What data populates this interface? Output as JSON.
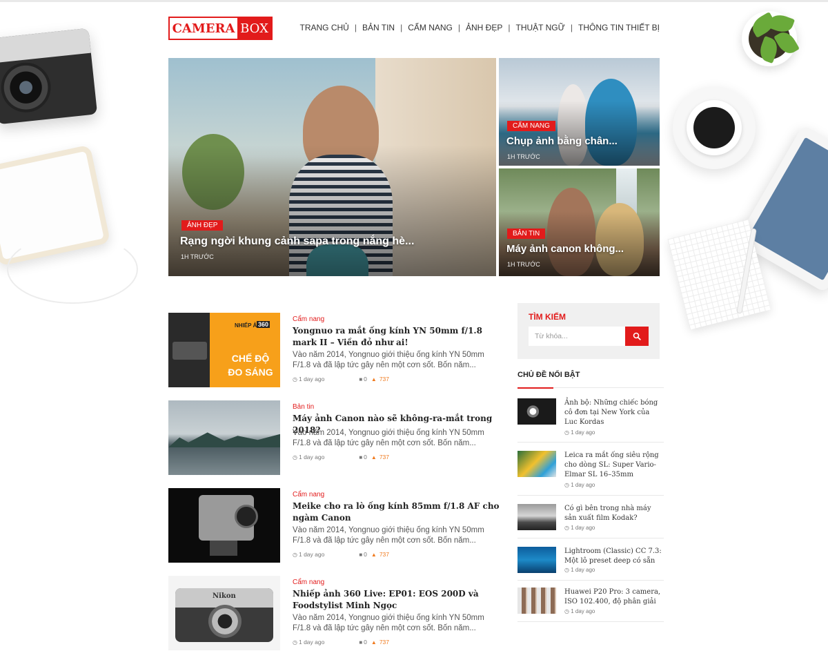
{
  "brand": {
    "logo_left": "CAMERA",
    "logo_right": "BOX",
    "accent_color": "#e21b1b"
  },
  "nav": [
    {
      "label": "TRANG CHỦ"
    },
    {
      "label": "BẢN TIN"
    },
    {
      "label": "CẨM NANG"
    },
    {
      "label": "ẢNH ĐẸP"
    },
    {
      "label": "THUẬT NGỮ"
    },
    {
      "label": "THÔNG TIN THIẾT BỊ"
    }
  ],
  "hero": {
    "main": {
      "category": "ẢNH ĐẸP",
      "title": "Rạng ngời khung cảnh sapa trong nắng hè...",
      "time": "1H TRƯỚC"
    },
    "side": [
      {
        "category": "CẨM NANG",
        "title": "Chụp ảnh bằng chân...",
        "time": "1H TRƯỚC"
      },
      {
        "category": "BẢN TIN",
        "title": "Máy ảnh canon không...",
        "time": "1H TRƯỚC"
      }
    ]
  },
  "articles": [
    {
      "category": "Cẩm nang",
      "title": "Yongnuo ra mắt ống kính YN 50mm f/1.8 mark II – Viền đỏ như ai!",
      "excerpt": "Vào năm 2014, Yongnuo giới thiệu ống kính YN 50mm F/1.8 và đã lập tức gây nên một cơn sốt. Bốn năm...",
      "time": "1 day ago",
      "comments": "0",
      "views": "737",
      "thumb": {
        "text1": "NHIẾP ẢNH",
        "text2": "360",
        "text3": "CHẾ ĐỘ",
        "text4": "ĐO SÁNG"
      }
    },
    {
      "category": "Bản tin",
      "title": "Máy ảnh Canon nào sẽ không-ra-mắt trong 2018?",
      "excerpt": "Vào năm 2014, Yongnuo giới thiệu ống kính YN 50mm F/1.8 và đã lập tức gây nên một cơn sốt. Bốn năm...",
      "time": "1 day ago",
      "comments": "0",
      "views": "737"
    },
    {
      "category": "Cẩm nang",
      "title": "Meike cho ra lò ống kính 85mm f/1.8 AF cho ngàm Canon",
      "excerpt": "Vào năm 2014, Yongnuo giới thiệu ống kính YN 50mm F/1.8 và đã lập tức gây nên một cơn sốt. Bốn năm...",
      "time": "1 day ago",
      "comments": "0",
      "views": "737"
    },
    {
      "category": "Cẩm nang",
      "title": "Nhiếp ảnh 360 Live: EP01: EOS 200D và Foodstylist Minh Ngọc",
      "excerpt": "Vào năm 2014, Yongnuo giới thiệu ống kính YN 50mm F/1.8 và đã lập tức gây nên một cơn sốt. Bốn năm...",
      "time": "1 day ago",
      "comments": "0",
      "views": "737",
      "thumb": {
        "brand": "Nikon"
      }
    }
  ],
  "sidebar": {
    "search": {
      "heading": "TÌM KIẾM",
      "placeholder": "Từ khóa..."
    },
    "featured_heading": "CHỦ ĐỀ NỔI BẬT",
    "featured": [
      {
        "title": "Ảnh bộ: Những chiếc bóng cô đơn tại New York của Luc Kordas",
        "time": "1 day ago"
      },
      {
        "title": "Leica ra mắt ống siêu rộng cho dòng SL: Super Vario-Elmar SL 16–35mm",
        "time": "1 day ago"
      },
      {
        "title": "Có gì bên trong nhà máy sản xuất film Kodak?",
        "time": "1 day ago"
      },
      {
        "title": "Lightroom (Classic) CC 7.3: Một lô preset deep có sẵn",
        "time": "1 day ago"
      },
      {
        "title": "Huawei P20 Pro: 3 camera, ISO 102.400, độ phân giải",
        "time": "1 day ago"
      }
    ]
  }
}
